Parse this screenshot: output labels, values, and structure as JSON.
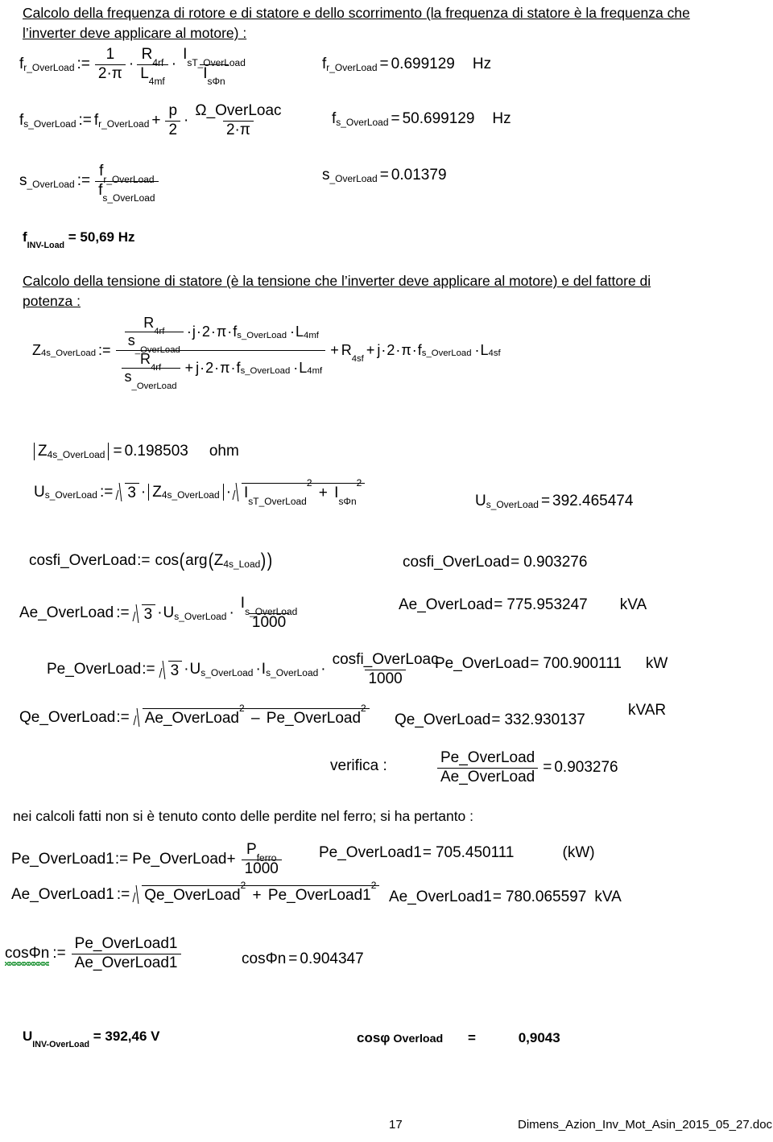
{
  "document": {
    "page_number": "17",
    "filename": "Dimens_Azion_Inv_Mot_Asin_2015_05_27.doc"
  },
  "section1": {
    "heading_line1": "Calcolo della frequenza di rotore e di statore e dello scorrimento (la frequenza di statore è la frequenza che",
    "heading_line2": "l’inverter deve applicare al motore) :",
    "eq_fr": {
      "lhs_base": "f",
      "lhs_sub": "r_OverLoad",
      "assign": ":=",
      "num1": "1",
      "den1_a": "2",
      "den1_b": "π",
      "num2_base": "R",
      "num2_sub": "4rf",
      "den2_base": "L",
      "den2_sub": "4mf",
      "num3_base": "I",
      "num3_sub": "sT_OverLoad",
      "den3_base": "I",
      "den3_sub": "sΦn"
    },
    "res_fr": {
      "base": "f",
      "sub": "r_OverLoad",
      "eq": "=",
      "value": "0.699129",
      "unit": "Hz"
    },
    "eq_fs": {
      "lhs_base": "f",
      "lhs_sub": "s_OverLoad",
      "assign": ":=",
      "term1_base": "f",
      "term1_sub": "r_OverLoad",
      "plus": "+",
      "num_p": "p",
      "den_2": "2",
      "num_omega": "Ω_OverLoac",
      "den_2pi_a": "2",
      "den_2pi_b": "π"
    },
    "res_fs": {
      "base": "f",
      "sub": "s_OverLoad",
      "eq": "=",
      "value": "50.699129",
      "unit": "Hz"
    },
    "eq_s": {
      "lhs_base": "s",
      "lhs_sub": "_OverLoad",
      "assign": ":=",
      "num_base": "f",
      "num_sub": "r_OverLoad",
      "den_base": "f",
      "den_sub": "s_OverLoad"
    },
    "res_s": {
      "base": "s",
      "sub": "_OverLoad",
      "eq": "=",
      "value": "0.01379"
    },
    "summary_finv": {
      "base": "f",
      "sub": "INV-Load",
      "rest": " = 50,69 Hz"
    }
  },
  "section2": {
    "heading_line1": "Calcolo della tensione di statore (è la tensione che l’inverter deve applicare al motore) e del fattore di",
    "heading_line2": "potenza :",
    "eq_z": {
      "lhs_base": "Z",
      "lhs_sub": "4s_OverLoad",
      "assign": ":=",
      "inner_num_R_base": "R",
      "inner_num_R_sub": "4rf",
      "inner_den_s_base": "s",
      "inner_den_s_sub": "_OverLoad",
      "mult_j": "j",
      "two": "2",
      "pi": "π",
      "f_base": "f",
      "f_sub": "s_OverLoad",
      "L_base": "L",
      "L_sub": "4mf",
      "plus": "+",
      "Rsf_base": "R",
      "Rsf_sub": "4sf",
      "Lsf_base": "L",
      "Lsf_sub": "4sf"
    },
    "res_z": {
      "base": "Z",
      "sub": "4s_OverLoad",
      "eq": "=",
      "value": "0.198503",
      "unit": "ohm"
    },
    "eq_us": {
      "lhs_base": "U",
      "lhs_sub": "s_OverLoad",
      "assign": ":=",
      "sqrt3": "3",
      "z_base": "Z",
      "z_sub": "4s_OverLoad",
      "i1_base": "I",
      "i1_sub": "sT_OverLoad",
      "i1_sup": "2",
      "plus": "+",
      "i2_base": "I",
      "i2_sub": "sΦn",
      "i2_sup": "2"
    },
    "res_us": {
      "base": "U",
      "sub": "s_OverLoad",
      "eq": "=",
      "value": "392.465474"
    },
    "eq_cosfi": {
      "lhs": "cosfi_OverLoad",
      "assign": ":=",
      "cos": "cos",
      "arg": "arg",
      "z_base": "Z",
      "z_sub": "4s_Load"
    },
    "res_cosfi": {
      "lhs": "cosfi_OverLoad",
      "eq": "=",
      "value": "0.903276"
    },
    "eq_ae": {
      "lhs": "Ae_OverLoad",
      "assign": ":=",
      "sqrt3": "3",
      "u_base": "U",
      "u_sub": "s_OverLoad",
      "num_base": "I",
      "num_sub": "s_OverLoad",
      "den": "1000"
    },
    "res_ae": {
      "lhs": "Ae_OverLoad",
      "eq": "=",
      "value": "775.953247",
      "unit": "kVA"
    },
    "eq_pe": {
      "lhs": "Pe_OverLoad",
      "assign": ":=",
      "sqrt3": "3",
      "u_base": "U",
      "u_sub": "s_OverLoad",
      "i_base": "I",
      "i_sub": "s_OverLoad",
      "num": "cosfi_OverLoac",
      "den": "1000"
    },
    "res_pe": {
      "lhs": "Pe_OverLoad",
      "eq": "=",
      "value": "700.900111",
      "unit": "kW"
    },
    "eq_qe": {
      "lhs": "Qe_OverLoad",
      "assign": ":=",
      "t1": "Ae_OverLoad",
      "t1_sup": "2",
      "minus": "–",
      "t2": "Pe_OverLoad",
      "t2_sup": "2"
    },
    "res_qe": {
      "lhs": "Qe_OverLoad",
      "eq": "=",
      "value": "332.930137",
      "unit": "kVAR"
    },
    "verifica": {
      "label": "verifica :",
      "num": "Pe_OverLoad",
      "den": "Ae_OverLoad",
      "eq": "=",
      "value": "0.903276"
    }
  },
  "section3": {
    "note": "nei calcoli fatti non si è tenuto conto delle perdite nel ferro; si ha pertanto :",
    "eq_pe1": {
      "lhs": "Pe_OverLoad1",
      "assign": ":=",
      "term": "Pe_OverLoad",
      "plus": "+",
      "num_base": "P",
      "num_sub": "ferro",
      "den": "1000"
    },
    "res_pe1": {
      "lhs": "Pe_OverLoad1",
      "eq": "=",
      "value": "705.450111",
      "unit": "(kW)"
    },
    "eq_ae1": {
      "lhs": "Ae_OverLoad1",
      "assign": ":=",
      "t1": "Qe_OverLoad",
      "t1_sup": "2",
      "plus": "+",
      "t2": "Pe_OverLoad1",
      "t2_sup": "2"
    },
    "res_ae1": {
      "lhs": "Ae_OverLoad1",
      "eq": "=",
      "value": "780.065597",
      "unit": "kVA"
    },
    "eq_cosphin": {
      "lhs": "cosΦn",
      "assign": ":=",
      "num": "Pe_OverLoad1",
      "den": "Ae_OverLoad1"
    },
    "res_cosphin": {
      "lhs": "cosΦn",
      "eq": "=",
      "value": "0.904347"
    }
  },
  "footer_summary": {
    "u_base": "U",
    "u_sub": "INV-OverLoad",
    "u_rest": " = 392,46 V",
    "cos_label": "cosφ",
    "cos_word": " Overload",
    "cos_eq": "=",
    "cos_value": "0,9043"
  }
}
